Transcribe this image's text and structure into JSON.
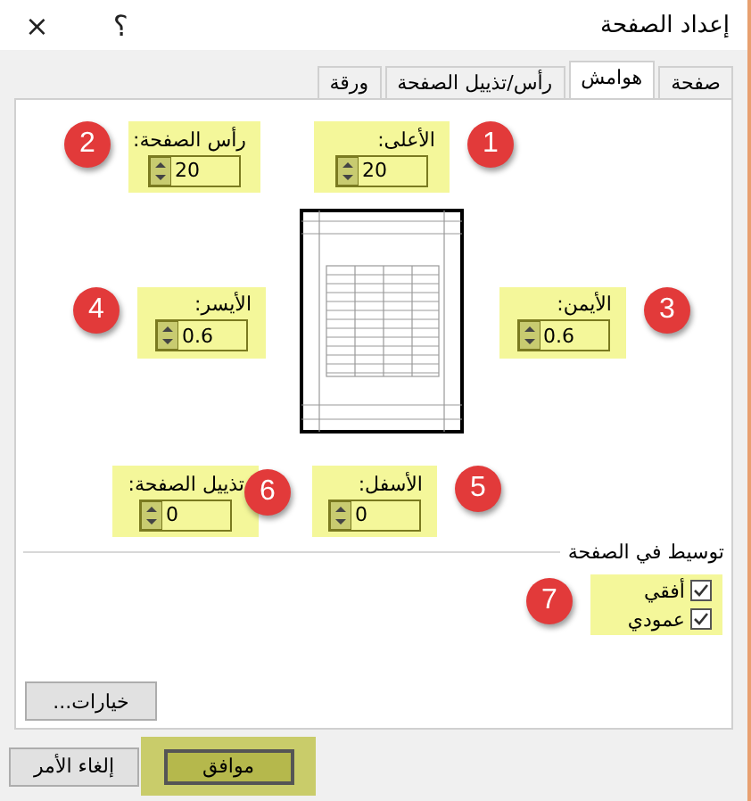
{
  "window": {
    "title": "إعداد الصفحة",
    "help": "؟",
    "close": "×"
  },
  "tabs": [
    {
      "label": "صفحة",
      "selected": false
    },
    {
      "label": "هوامش",
      "selected": true
    },
    {
      "label": "رأس/تذييل الصفحة",
      "selected": false
    },
    {
      "label": "ورقة",
      "selected": false
    }
  ],
  "margins": [
    {
      "label": "الأعلى:",
      "value": "20",
      "badge": "1"
    },
    {
      "label": "رأس الصفحة:",
      "value": "20",
      "badge": "2"
    },
    {
      "label": "الأيمن:",
      "value": "0.6",
      "badge": "3"
    },
    {
      "label": "الأيسر:",
      "value": "0.6",
      "badge": "4"
    },
    {
      "label": "الأسفل:",
      "value": "0",
      "badge": "5"
    },
    {
      "label": "تذييل الصفحة:",
      "value": "0",
      "badge": "6"
    }
  ],
  "center": {
    "title": "توسيط في الصفحة",
    "badge": "7",
    "options": [
      {
        "label": "أفقي",
        "checked": true
      },
      {
        "label": "عمودي",
        "checked": true
      }
    ]
  },
  "options_button": "خيارات...",
  "buttons": {
    "ok": "موافق",
    "cancel": "إلغاء الأمر"
  }
}
